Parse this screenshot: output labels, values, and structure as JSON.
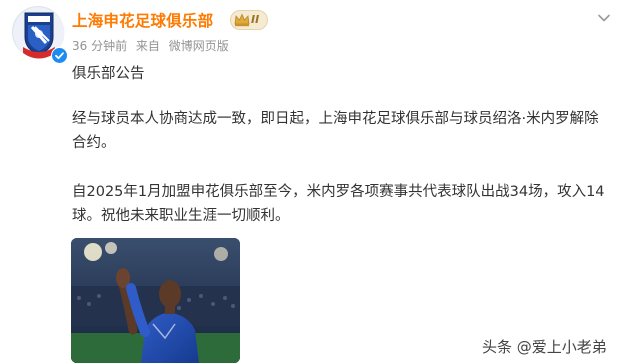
{
  "post": {
    "account_name": "上海申花足球俱乐部",
    "level_badge": "II",
    "time": "36 分钟前",
    "source_prefix": "来自",
    "source": "微博网页版",
    "paragraphs": [
      "俱乐部公告",
      "经与球员本人协商达成一致，即日起，上海申花足球俱乐部与球员绍洛·米内罗解除合约。",
      "自2025年1月加盟申花俱乐部至今，米内罗各项赛事共代表球队出战34场，攻入14球。祝他未来职业生涯一切顺利。"
    ]
  },
  "icons": {
    "avatar": "shenhua-logo-icon",
    "verified": "verified-check-icon",
    "badge": "crown-icon",
    "more": "chevron-down-icon"
  },
  "colors": {
    "account_name": "#ff7a00",
    "meta": "#939393",
    "body_text": "#333333",
    "verified": "#1d8cf0"
  },
  "watermark": "头条 @爱上小老弟"
}
